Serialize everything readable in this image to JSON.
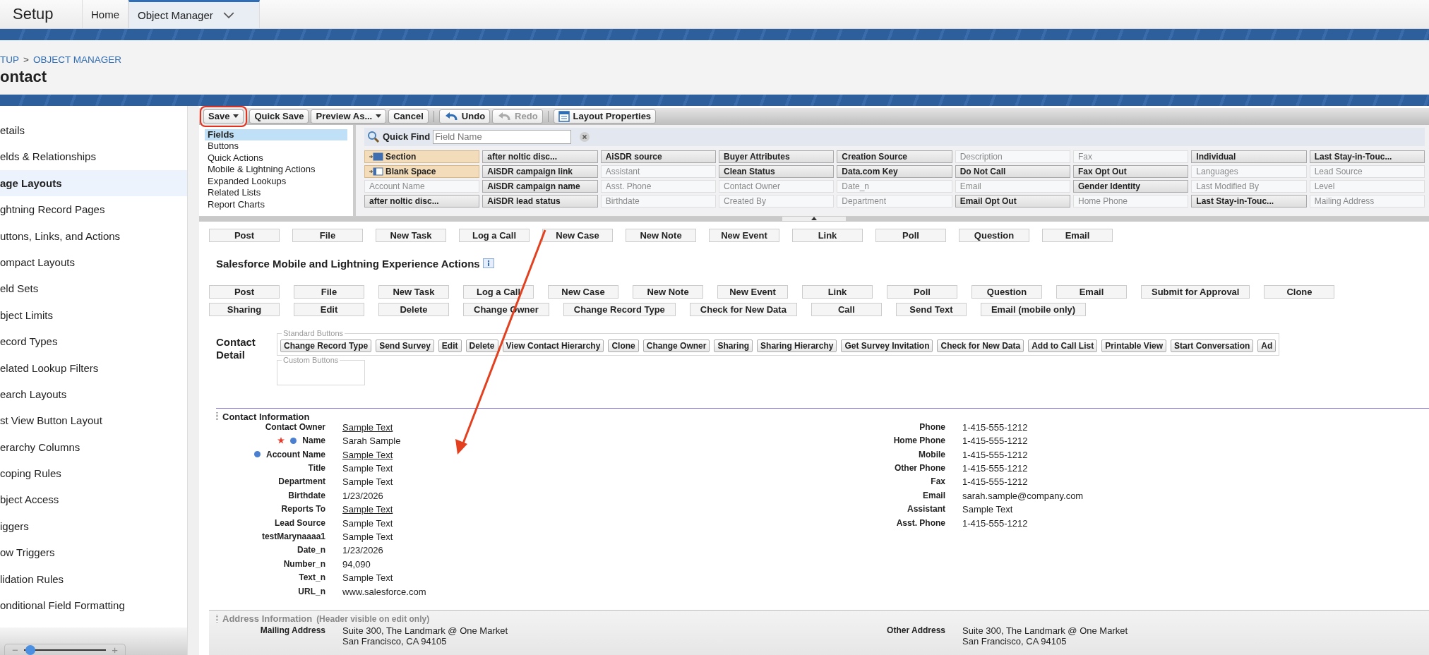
{
  "app_title": "Setup",
  "tabs": [
    {
      "label": "Home",
      "selected": false,
      "menu": false
    },
    {
      "label": "Object Manager",
      "selected": true,
      "menu": true
    }
  ],
  "breadcrumb": {
    "items": [
      "TUP",
      "OBJECT MANAGER"
    ],
    "separator": ">"
  },
  "page_title": "ontact",
  "sidebar": {
    "items": [
      {
        "label": "etails",
        "selected": false
      },
      {
        "label": "elds & Relationships",
        "selected": false
      },
      {
        "label": "age Layouts",
        "selected": true
      },
      {
        "label": "ghtning Record Pages",
        "selected": false
      },
      {
        "label": "uttons, Links, and Actions",
        "selected": false
      },
      {
        "label": "ompact Layouts",
        "selected": false
      },
      {
        "label": "eld Sets",
        "selected": false
      },
      {
        "label": "bject Limits",
        "selected": false
      },
      {
        "label": "ecord Types",
        "selected": false
      },
      {
        "label": "elated Lookup Filters",
        "selected": false
      },
      {
        "label": "earch Layouts",
        "selected": false
      },
      {
        "label": "st View Button Layout",
        "selected": false
      },
      {
        "label": "erarchy Columns",
        "selected": false
      },
      {
        "label": "coping Rules",
        "selected": false
      },
      {
        "label": "bject Access",
        "selected": false
      },
      {
        "label": "iggers",
        "selected": false
      },
      {
        "label": "ow Triggers",
        "selected": false
      },
      {
        "label": "lidation Rules",
        "selected": false
      },
      {
        "label": "onditional Field Formatting",
        "selected": false
      }
    ],
    "zoom": {
      "minus": "−",
      "plus": "+",
      "level": 0.08
    }
  },
  "toolbar": [
    {
      "kind": "button",
      "label": "Save",
      "dropdown": true,
      "disabled": false,
      "highlighted": true
    },
    {
      "kind": "button",
      "label": "Quick Save",
      "dropdown": false,
      "disabled": false,
      "highlighted": false
    },
    {
      "kind": "button",
      "label": "Preview As...",
      "dropdown": true,
      "disabled": false,
      "highlighted": false
    },
    {
      "kind": "button",
      "label": "Cancel",
      "dropdown": false,
      "disabled": false,
      "highlighted": false
    },
    {
      "kind": "undo",
      "label": "Undo",
      "dropdown": false,
      "disabled": false,
      "highlighted": false
    },
    {
      "kind": "redo",
      "label": "Redo",
      "dropdown": false,
      "disabled": true,
      "highlighted": false
    },
    {
      "kind": "properties",
      "label": "Layout Properties",
      "dropdown": false,
      "disabled": false,
      "highlighted": false
    }
  ],
  "palette": {
    "categories": [
      {
        "label": "Fields",
        "selected": true
      },
      {
        "label": "Buttons",
        "selected": false
      },
      {
        "label": "Quick Actions",
        "selected": false
      },
      {
        "label": "Mobile & Lightning Actions",
        "selected": false
      },
      {
        "label": "Expanded Lookups",
        "selected": false
      },
      {
        "label": "Related Lists",
        "selected": false
      },
      {
        "label": "Report Charts",
        "selected": false
      }
    ],
    "quick_find": {
      "label": "Quick Find",
      "placeholder": "Field Name"
    },
    "items": [
      {
        "kind": "section",
        "label": "Section",
        "used": false
      },
      {
        "kind": "field",
        "label": "after noltic disc...",
        "used": false
      },
      {
        "kind": "field",
        "label": "AiSDR source",
        "used": false
      },
      {
        "kind": "field",
        "label": "Buyer Attributes",
        "used": false
      },
      {
        "kind": "field",
        "label": "Creation Source",
        "used": false
      },
      {
        "kind": "field",
        "label": "Description",
        "used": true
      },
      {
        "kind": "field",
        "label": "Fax",
        "used": true
      },
      {
        "kind": "field",
        "label": "Individual",
        "used": false
      },
      {
        "kind": "field",
        "label": "Last Stay-in-Touc...",
        "used": false
      },
      {
        "kind": "blank",
        "label": "Blank Space",
        "used": false
      },
      {
        "kind": "field",
        "label": "AiSDR campaign link",
        "used": false
      },
      {
        "kind": "field",
        "label": "Assistant",
        "used": true
      },
      {
        "kind": "field",
        "label": "Clean Status",
        "used": false
      },
      {
        "kind": "field",
        "label": "Data.com Key",
        "used": false
      },
      {
        "kind": "field",
        "label": "Do Not Call",
        "used": false
      },
      {
        "kind": "field",
        "label": "Fax Opt Out",
        "used": false
      },
      {
        "kind": "field",
        "label": "Languages",
        "used": true
      },
      {
        "kind": "field",
        "label": "Lead Source",
        "used": true
      },
      {
        "kind": "field",
        "label": "Account Name",
        "used": true
      },
      {
        "kind": "field",
        "label": "AiSDR campaign name",
        "used": false
      },
      {
        "kind": "field",
        "label": "Asst. Phone",
        "used": true
      },
      {
        "kind": "field",
        "label": "Contact Owner",
        "used": true
      },
      {
        "kind": "field",
        "label": "Date_n",
        "used": true
      },
      {
        "kind": "field",
        "label": "Email",
        "used": true
      },
      {
        "kind": "field",
        "label": "Gender Identity",
        "used": false
      },
      {
        "kind": "field",
        "label": "Last Modified By",
        "used": true
      },
      {
        "kind": "field",
        "label": "Level",
        "used": true
      },
      {
        "kind": "field",
        "label": "after noltic disc...",
        "used": false
      },
      {
        "kind": "field",
        "label": "AiSDR lead status",
        "used": false
      },
      {
        "kind": "field",
        "label": "Birthdate",
        "used": true
      },
      {
        "kind": "field",
        "label": "Created By",
        "used": true
      },
      {
        "kind": "field",
        "label": "Department",
        "used": true
      },
      {
        "kind": "field",
        "label": "Email Opt Out",
        "used": false
      },
      {
        "kind": "field",
        "label": "Home Phone",
        "used": true
      },
      {
        "kind": "field",
        "label": "Last Stay-in-Touc...",
        "used": false
      },
      {
        "kind": "field",
        "label": "Mailing Address",
        "used": true
      }
    ]
  },
  "publisher_actions": [
    "Post",
    "File",
    "New Task",
    "Log a Call",
    "New Case",
    "New Note",
    "New Event",
    "Link",
    "Poll",
    "Question",
    "Email"
  ],
  "mobile_actions": {
    "title": "Salesforce Mobile and Lightning Experience Actions",
    "items": [
      "Post",
      "File",
      "New Task",
      "Log a Call",
      "New Case",
      "New Note",
      "New Event",
      "Link",
      "Poll",
      "Question",
      "Email",
      "Submit for Approval",
      "Clone",
      "Sharing",
      "Edit",
      "Delete",
      "Change Owner",
      "Change Record Type",
      "Check for New Data",
      "Call",
      "Send Text",
      "Email (mobile only)"
    ]
  },
  "contact_detail": {
    "title": "Contact Detail",
    "standard_legend": "Standard Buttons",
    "standard_buttons": [
      "Change Record Type",
      "Send Survey",
      "Edit",
      "Delete",
      "View Contact Hierarchy",
      "Clone",
      "Change Owner",
      "Sharing",
      "Sharing Hierarchy",
      "Get Survey Invitation",
      "Check for New Data",
      "Add to Call List",
      "Printable View",
      "Start Conversation",
      "Ad"
    ],
    "custom_legend": "Custom Buttons"
  },
  "contact_information": {
    "title": "Contact Information",
    "left": [
      {
        "label": "Contact Owner",
        "value": "Sample Text",
        "required": false,
        "dot": false,
        "lookup": true
      },
      {
        "label": "Name",
        "value": "Sarah Sample",
        "required": true,
        "dot": true,
        "lookup": false
      },
      {
        "label": "Account Name",
        "value": "Sample Text",
        "required": false,
        "dot": true,
        "lookup": true
      },
      {
        "label": "Title",
        "value": "Sample Text",
        "required": false,
        "dot": false,
        "lookup": false
      },
      {
        "label": "Department",
        "value": "Sample Text",
        "required": false,
        "dot": false,
        "lookup": false
      },
      {
        "label": "Birthdate",
        "value": "1/23/2026",
        "required": false,
        "dot": false,
        "lookup": false
      },
      {
        "label": "Reports To",
        "value": "Sample Text",
        "required": false,
        "dot": false,
        "lookup": true
      },
      {
        "label": "Lead Source",
        "value": "Sample Text",
        "required": false,
        "dot": false,
        "lookup": false
      },
      {
        "label": "testMarynaaaa1",
        "value": "Sample Text",
        "required": false,
        "dot": false,
        "lookup": false
      },
      {
        "label": "Date_n",
        "value": "1/23/2026",
        "required": false,
        "dot": false,
        "lookup": false
      },
      {
        "label": "Number_n",
        "value": "94,090",
        "required": false,
        "dot": false,
        "lookup": false
      },
      {
        "label": "Text_n",
        "value": "Sample Text",
        "required": false,
        "dot": false,
        "lookup": false
      },
      {
        "label": "URL_n",
        "value": "www.salesforce.com",
        "required": false,
        "dot": false,
        "lookup": false
      }
    ],
    "right": [
      {
        "label": "Phone",
        "value": "1-415-555-1212"
      },
      {
        "label": "Home Phone",
        "value": "1-415-555-1212"
      },
      {
        "label": "Mobile",
        "value": "1-415-555-1212"
      },
      {
        "label": "Other Phone",
        "value": "1-415-555-1212"
      },
      {
        "label": "Fax",
        "value": "1-415-555-1212"
      },
      {
        "label": "Email",
        "value": "sarah.sample@company.com"
      },
      {
        "label": "Assistant",
        "value": "Sample Text"
      },
      {
        "label": "Asst. Phone",
        "value": "1-415-555-1212"
      }
    ]
  },
  "address_information": {
    "title": "Address Information",
    "note": "(Header visible on edit only)",
    "left": {
      "label": "Mailing Address",
      "lines": [
        "Suite 300, The Landmark @ One Market",
        "San Francisco, CA 94105"
      ]
    },
    "right": {
      "label": "Other Address",
      "lines": [
        "Suite 300, The Landmark @ One Market",
        "San Francisco, CA 94105"
      ]
    }
  }
}
